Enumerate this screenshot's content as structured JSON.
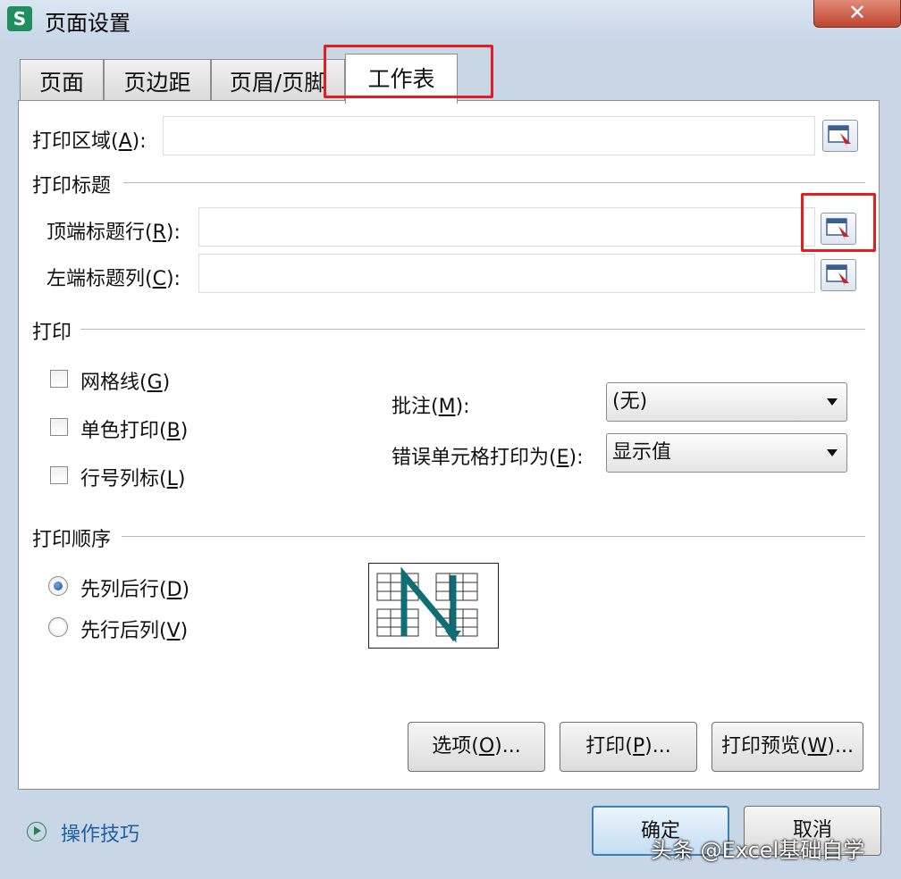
{
  "window": {
    "title": "页面设置",
    "app_icon_letter": "S",
    "close_glyph": "✕"
  },
  "tabs": [
    {
      "label": "页面"
    },
    {
      "label": "页边距"
    },
    {
      "label": "页眉/页脚"
    },
    {
      "label": "工作表",
      "active": true
    }
  ],
  "print_area": {
    "label": "打印区域(",
    "key": "A",
    "suffix": "):",
    "value": ""
  },
  "print_titles": {
    "section": "打印标题",
    "top_rows": {
      "label": "顶端标题行(",
      "key": "R",
      "suffix": "):",
      "value": ""
    },
    "left_cols": {
      "label": "左端标题列(",
      "key": "C",
      "suffix": "):",
      "value": ""
    }
  },
  "print": {
    "section": "打印",
    "gridlines": {
      "label": "网格线(",
      "key": "G",
      "suffix": ")",
      "checked": false
    },
    "mono": {
      "label": "单色打印(",
      "key": "B",
      "suffix": ")",
      "checked": false
    },
    "headings": {
      "label": "行号列标(",
      "key": "L",
      "suffix": ")",
      "checked": false
    },
    "comments": {
      "label": "批注(",
      "key": "M",
      "suffix": "):",
      "value": "(无)"
    },
    "errors": {
      "label": "错误单元格打印为(",
      "key": "E",
      "suffix": "):",
      "value": "显示值"
    }
  },
  "order": {
    "section": "打印顺序",
    "down_then_over": {
      "label": "先列后行(",
      "key": "D",
      "suffix": ")",
      "selected": true
    },
    "over_then_down": {
      "label": "先行后列(",
      "key": "V",
      "suffix": ")",
      "selected": false
    }
  },
  "buttons": {
    "options": {
      "label": "选项(",
      "key": "O",
      "suffix": ")..."
    },
    "print": {
      "label": "打印(",
      "key": "P",
      "suffix": ")..."
    },
    "preview": {
      "label": "打印预览(",
      "key": "W",
      "suffix": ")..."
    },
    "ok": "确定",
    "cancel": "取消"
  },
  "tips": "操作技巧",
  "watermark": "头条 @Excel基础自学",
  "colors": {
    "highlight": "#e02020",
    "accent": "#1d5fa8"
  }
}
